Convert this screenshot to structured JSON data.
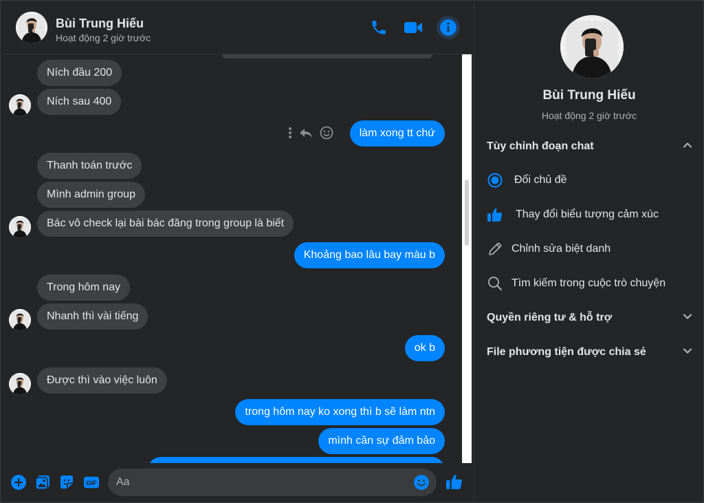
{
  "contact": {
    "name": "Bùi Trung Hiếu",
    "status": "Hoạt động 2 giờ trước"
  },
  "header": {
    "icons": [
      "phone-icon",
      "video-camera-icon",
      "info-icon"
    ]
  },
  "messages": [
    {
      "side": "in",
      "text": "Ních đầu 200"
    },
    {
      "side": "in",
      "text": "Ních sau 400"
    },
    {
      "side": "out",
      "text": "làm xong tt chứ"
    },
    {
      "side": "in",
      "text": "Thanh toán trước"
    },
    {
      "side": "in",
      "text": "Mình admin group"
    },
    {
      "side": "in",
      "text": "Bác vô check lại bài bác đăng trong group là biết"
    },
    {
      "side": "out",
      "text": "Khoảng bao lâu bay màu b"
    },
    {
      "side": "in",
      "text": "Trong hôm nay"
    },
    {
      "side": "in",
      "text": "Nhanh thì vài tiếng"
    },
    {
      "side": "out",
      "text": "ok b"
    },
    {
      "side": "in",
      "text": "Được thì vào việc luôn"
    },
    {
      "side": "out",
      "text": "trong hôm nay ko xong thì b sẽ làm ntn"
    },
    {
      "side": "out",
      "text": "mình cần sự đảm bảo"
    }
  ],
  "composer": {
    "placeholder": "Aa",
    "icons": [
      "plus-icon",
      "image-icon",
      "sticker-icon",
      "gif-icon",
      "emoji-icon",
      "thumbs-up-icon"
    ],
    "gif_label": "GIF"
  },
  "info_panel": {
    "customize_title": "Tùy chỉnh đoạn chat",
    "options": [
      {
        "icon": "theme-icon",
        "label": "Đổi chủ đề"
      },
      {
        "icon": "thumbs-up-icon",
        "label": "Thay đổi biểu tượng cảm xúc"
      },
      {
        "icon": "pencil-icon",
        "label": "Chỉnh sửa biệt danh"
      },
      {
        "icon": "search-icon",
        "label": "Tìm kiếm trong cuộc trò chuyện"
      }
    ],
    "privacy_title": "Quyền riêng tư & hỗ trợ",
    "media_title": "File phương tiện được chia sẻ"
  },
  "colors": {
    "accent": "#0084ff",
    "background": "#242526",
    "incoming_bubble": "#3e4042"
  }
}
